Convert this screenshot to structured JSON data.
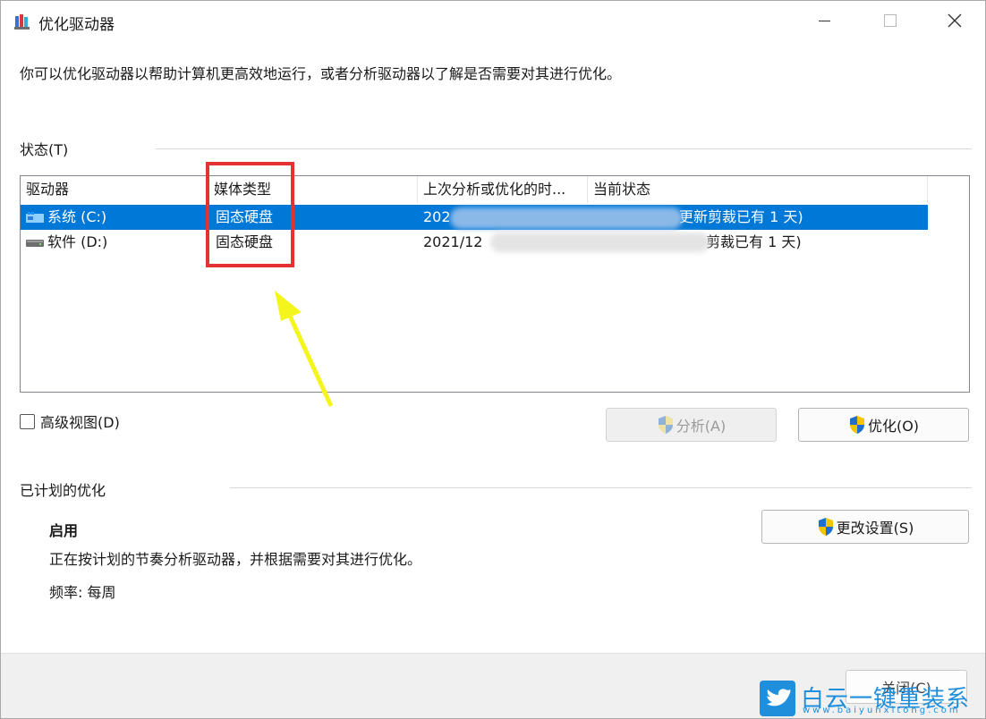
{
  "window": {
    "title": "优化驱动器"
  },
  "intro_text": "你可以优化驱动器以帮助计算机更高效地运行，或者分析驱动器以了解是否需要对其进行优化。",
  "status_section": {
    "label": "状态(T)"
  },
  "drive_list": {
    "columns": [
      "驱动器",
      "媒体类型",
      "上次分析或优化的时...",
      "当前状态"
    ],
    "rows": [
      {
        "drive": "系统 (C:)",
        "media": "固态硬盘",
        "last": "202",
        "status": "更新剪裁已有 1 天)"
      },
      {
        "drive": "软件 (D:)",
        "media": "固态硬盘",
        "last": "2021/12",
        "status": "剪裁已有 1 天)"
      }
    ]
  },
  "advanced_view": {
    "label": "高级视图(D)"
  },
  "buttons": {
    "analyze": "分析(A)",
    "optimize": "优化(O)",
    "change_settings": "更改设置(S)",
    "close": "关闭(C)"
  },
  "scheduled_section": {
    "label": "已计划的优化",
    "state": "启用",
    "description": "正在按计划的节奏分析驱动器，并根据需要对其进行优化。",
    "frequency": "频率: 每周"
  },
  "watermark": {
    "name": "白云一键重装系统",
    "url": "www.baiyunxitong.com"
  },
  "colors": {
    "selection": "#0078d7",
    "highlight_box": "#e23232",
    "arrow": "#f5f51e",
    "watermark": "#1f8fdc"
  }
}
